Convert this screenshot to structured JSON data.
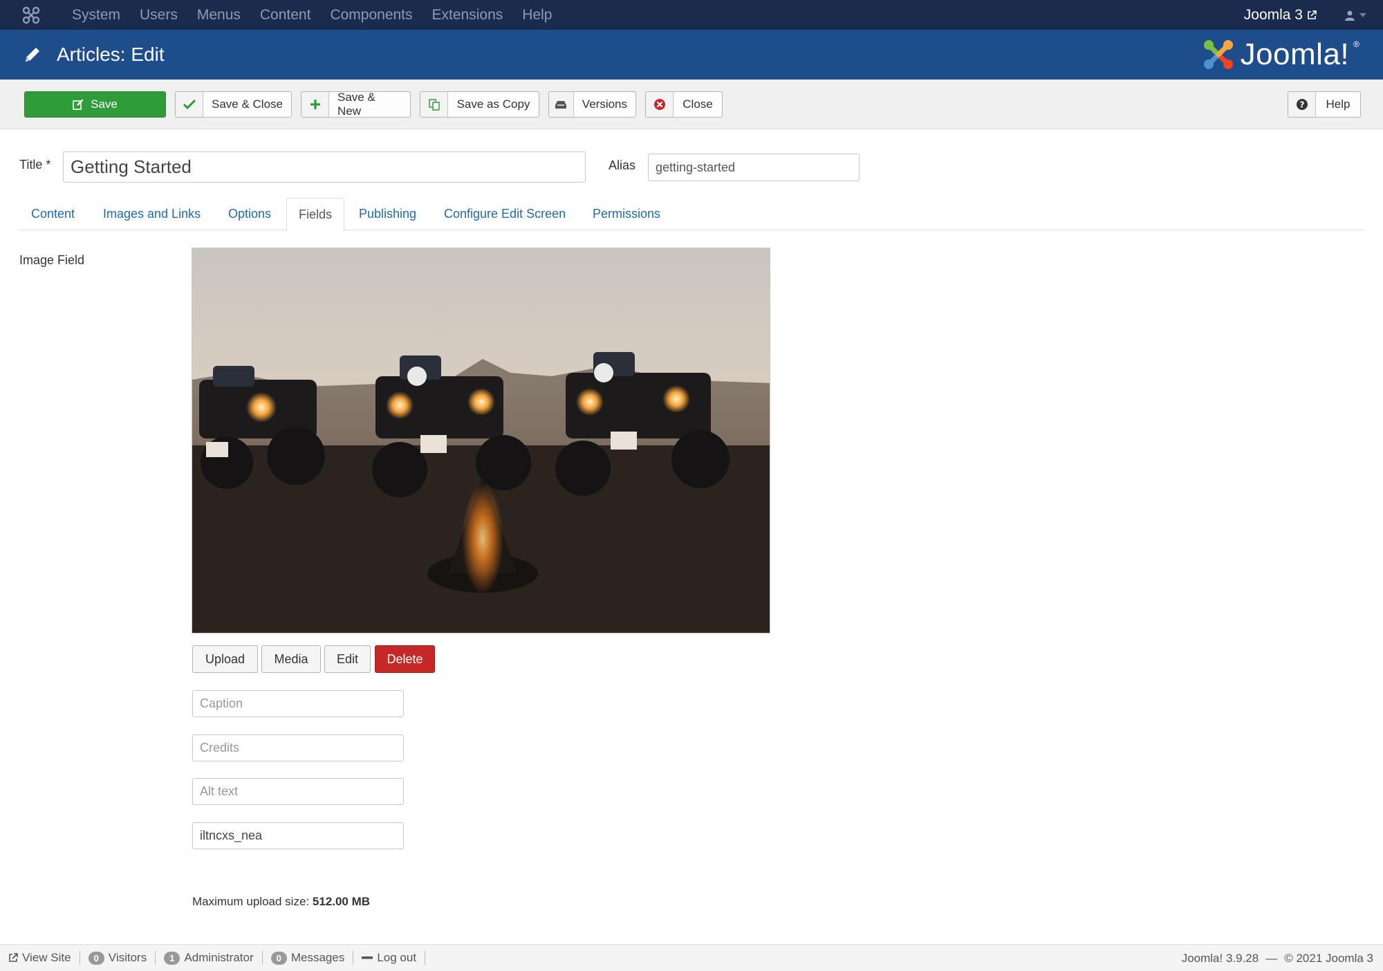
{
  "topnav": {
    "menu": [
      "System",
      "Users",
      "Menus",
      "Content",
      "Components",
      "Extensions",
      "Help"
    ],
    "site_label": "Joomla 3"
  },
  "header": {
    "title": "Articles: Edit",
    "brand": "Joomla!",
    "brand_reg": "®"
  },
  "toolbar": {
    "save": "Save",
    "save_close": "Save & Close",
    "save_new": "Save & New",
    "save_copy": "Save as Copy",
    "versions": "Versions",
    "close": "Close",
    "help": "Help"
  },
  "form": {
    "title_label": "Title *",
    "title_value": "Getting Started",
    "alias_label": "Alias",
    "alias_value": "getting-started"
  },
  "tabs": [
    "Content",
    "Images and Links",
    "Options",
    "Fields",
    "Publishing",
    "Configure Edit Screen",
    "Permissions"
  ],
  "active_tab": "Fields",
  "image_field": {
    "label": "Image Field",
    "buttons": {
      "upload": "Upload",
      "media": "Media",
      "edit": "Edit",
      "delete": "Delete"
    },
    "caption_placeholder": "Caption",
    "credits_placeholder": "Credits",
    "alt_placeholder": "Alt text",
    "filename_value": "iltncxs_nea",
    "max_upload_label": "Maximum upload size:",
    "max_upload_value": "512.00 MB"
  },
  "statusbar": {
    "view_site": "View Site",
    "visitors_count": "0",
    "visitors_label": "Visitors",
    "admin_count": "1",
    "admin_label": "Administrator",
    "messages_count": "0",
    "messages_label": "Messages",
    "logout": "Log out",
    "version": "Joomla! 3.9.28",
    "separator": "—",
    "copyright": "© 2021 Joomla 3"
  },
  "colors": {
    "topnav_bg": "#1a2b4d",
    "header_bg": "#1e4d8c",
    "save_green": "#2f9c3a",
    "delete_red": "#c52827",
    "link_blue": "#1e69b4"
  }
}
